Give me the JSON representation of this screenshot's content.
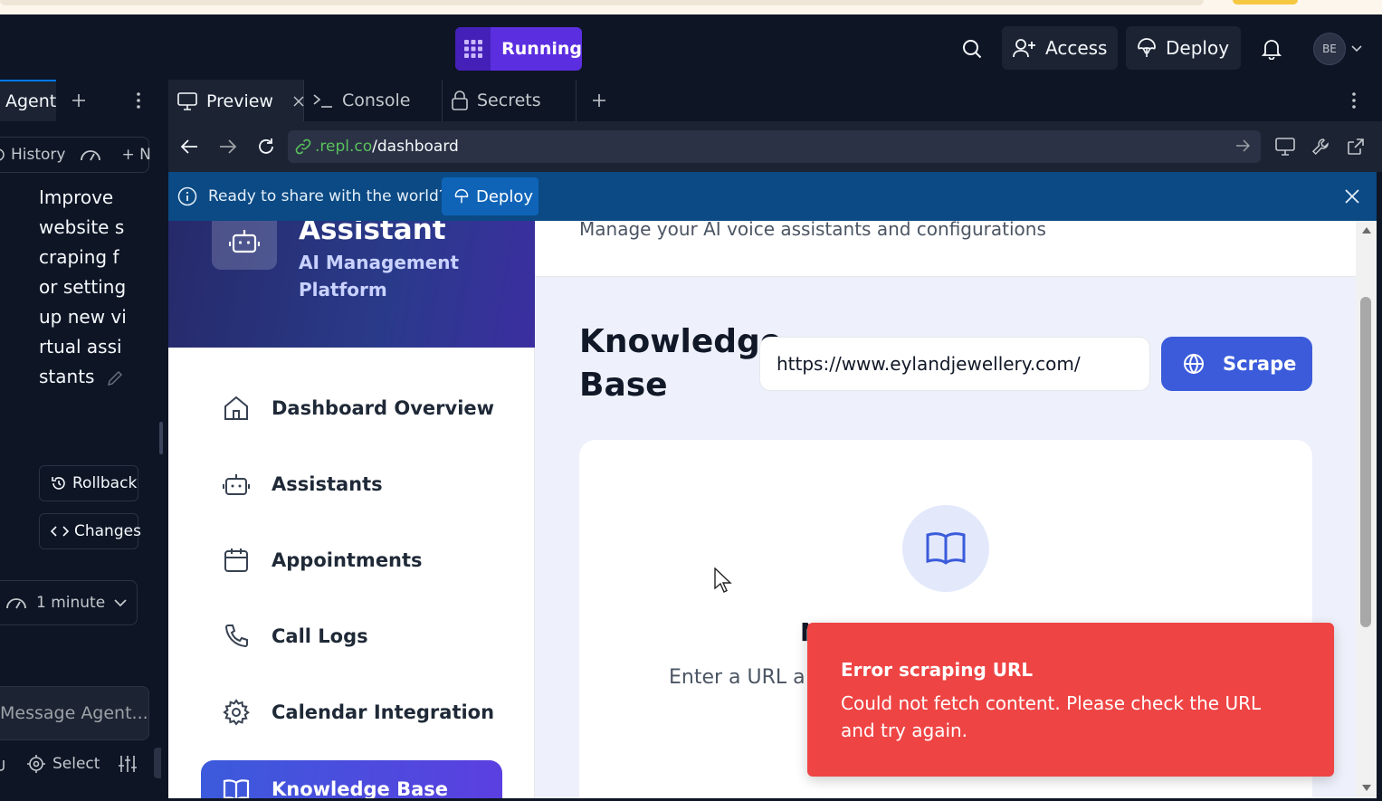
{
  "header": {
    "run_label": "Running",
    "access_label": "Access",
    "deploy_label": "Deploy",
    "avatar_initials": "BE"
  },
  "agent": {
    "tab_label": "Agent",
    "history_label": "History",
    "new_label": "+ N",
    "task_text": "Improve website scraping for setting up new virtual assistants",
    "rollback_label": "Rollback",
    "changes_label": "Changes",
    "time_label": "1 minute",
    "message_placeholder": "Message Agent...",
    "select_label": "Select"
  },
  "tabs": [
    {
      "label": "Preview"
    },
    {
      "label": "Console"
    },
    {
      "label": "Secrets"
    }
  ],
  "url": {
    "domain": ".repl.co",
    "path": "/dashboard"
  },
  "banner": {
    "text": "Ready to share with the world?",
    "deploy_label": "Deploy"
  },
  "app": {
    "brand_title": "Assistant",
    "brand_subtitle": "AI Management Platform",
    "header_text": "Manage your AI voice assistants and configurations",
    "nav": [
      {
        "label": "Dashboard Overview",
        "icon": "home-icon"
      },
      {
        "label": "Assistants",
        "icon": "robot-icon"
      },
      {
        "label": "Appointments",
        "icon": "calendar-icon"
      },
      {
        "label": "Call Logs",
        "icon": "phone-icon"
      },
      {
        "label": "Calendar Integration",
        "icon": "gear-icon"
      },
      {
        "label": "Knowledge Base",
        "icon": "book-icon"
      }
    ],
    "kb_title": "Knowledge Base",
    "kb_input_value": "https://www.eylandjewellery.com/",
    "scrape_label": "Scrape",
    "card_heading_partial": "N",
    "card_sub_partial": "Enter a URL a"
  },
  "toast": {
    "title": "Error scraping URL",
    "message": "Could not fetch content. Please check the URL and try again."
  },
  "colors": {
    "accent": "#3b5bdb",
    "run": "#5b2ee0",
    "error": "#ef4444",
    "banner": "#0b4a84"
  }
}
